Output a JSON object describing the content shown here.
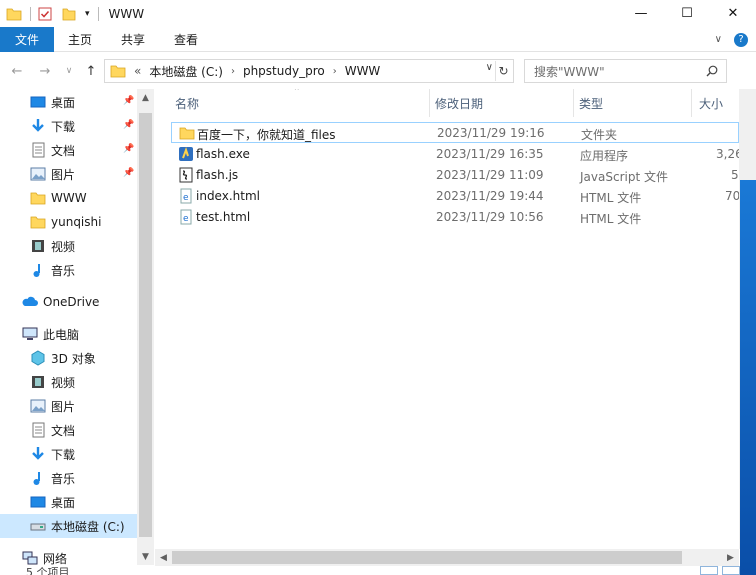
{
  "window": {
    "title": "WWW",
    "controls": {
      "minimize": "—",
      "maximize": "☐",
      "close": "✕"
    }
  },
  "ribbon": {
    "tabs": [
      {
        "label": "文件"
      },
      {
        "label": "主页"
      },
      {
        "label": "共享"
      },
      {
        "label": "查看"
      }
    ],
    "collapse_icon": "chevron-down-icon",
    "help_icon": "help-icon"
  },
  "address": {
    "back_icon": "←",
    "forward_icon": "→",
    "recent_icon": "∨",
    "up_icon": "↑",
    "overflow": "«",
    "crumbs": [
      "本地磁盘 (C:)",
      "phpstudy_pro",
      "WWW"
    ],
    "dropdown_icon": "∨",
    "refresh_icon": "↻"
  },
  "search": {
    "placeholder": "搜索\"WWW\""
  },
  "nav": {
    "quick": [
      {
        "label": "桌面",
        "icon": "desktop-icon",
        "pinned": true
      },
      {
        "label": "下载",
        "icon": "download-icon",
        "pinned": true
      },
      {
        "label": "文档",
        "icon": "document-icon",
        "pinned": true
      },
      {
        "label": "图片",
        "icon": "picture-icon",
        "pinned": true
      },
      {
        "label": "WWW",
        "icon": "folder-icon",
        "pinned": false
      },
      {
        "label": "yunqishi",
        "icon": "folder-icon",
        "pinned": false
      },
      {
        "label": "视频",
        "icon": "video-icon",
        "pinned": false
      },
      {
        "label": "音乐",
        "icon": "music-icon",
        "pinned": false
      }
    ],
    "onedrive": {
      "label": "OneDrive",
      "icon": "cloud-icon"
    },
    "thispc": {
      "label": "此电脑",
      "icon": "computer-icon"
    },
    "pc_items": [
      {
        "label": "3D 对象",
        "icon": "cube-icon"
      },
      {
        "label": "视频",
        "icon": "video-icon"
      },
      {
        "label": "图片",
        "icon": "picture-icon"
      },
      {
        "label": "文档",
        "icon": "document-icon"
      },
      {
        "label": "下载",
        "icon": "download-icon"
      },
      {
        "label": "音乐",
        "icon": "music-icon"
      },
      {
        "label": "桌面",
        "icon": "desktop-icon"
      },
      {
        "label": "本地磁盘 (C:)",
        "icon": "drive-icon",
        "selected": true
      }
    ],
    "network": {
      "label": "网络",
      "icon": "network-icon"
    }
  },
  "columns": {
    "name": "名称",
    "modified": "修改日期",
    "type": "类型",
    "size": "大小"
  },
  "files": [
    {
      "name": "百度一下，你就知道_files",
      "modified": "2023/11/29 19:16",
      "type": "文件夹",
      "size": "",
      "icon": "folder-icon"
    },
    {
      "name": "flash.exe",
      "modified": "2023/11/29 16:35",
      "type": "应用程序",
      "size": "3,26",
      "icon": "exe-icon"
    },
    {
      "name": "flash.js",
      "modified": "2023/11/29 11:09",
      "type": "JavaScript 文件",
      "size": "5",
      "icon": "js-file-icon"
    },
    {
      "name": "index.html",
      "modified": "2023/11/29 19:44",
      "type": "HTML 文件",
      "size": "70",
      "icon": "html-file-icon"
    },
    {
      "name": "test.html",
      "modified": "2023/11/29 10:56",
      "type": "HTML 文件",
      "size": "",
      "icon": "html-file-icon"
    }
  ],
  "status": {
    "text": "5 个项目"
  },
  "colors": {
    "accent": "#1979ca",
    "selection": "#cce8ff",
    "focus_border": "#99d1ff",
    "header_text": "#4c607a",
    "folder": "#ffd75e"
  }
}
